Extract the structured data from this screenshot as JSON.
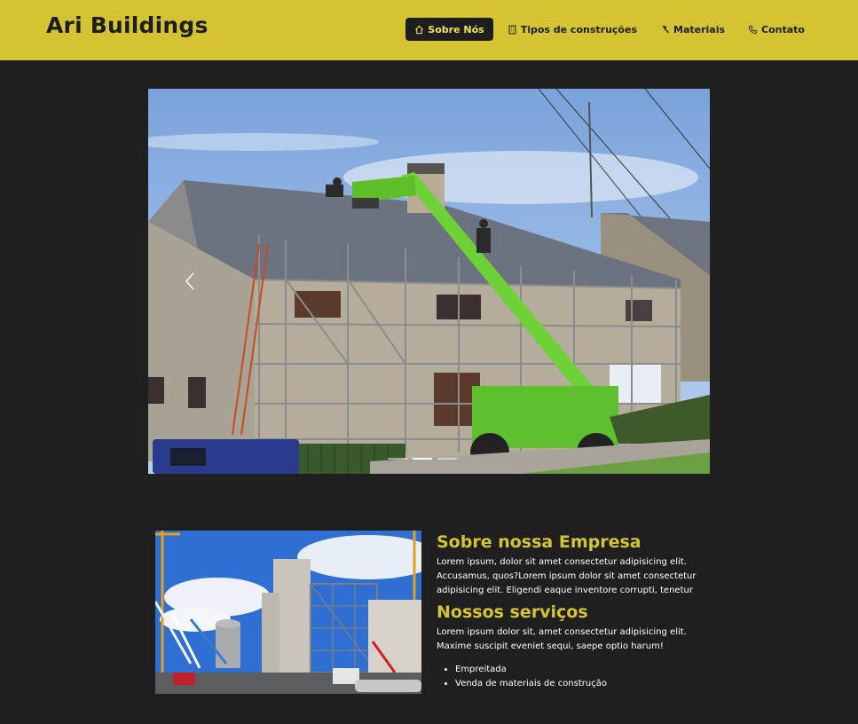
{
  "brand": {
    "name": "Ari Buildings"
  },
  "nav": {
    "items": [
      {
        "label": "Sobre Nós",
        "icon": "house-icon",
        "active": true
      },
      {
        "label": "Tipos de construções",
        "icon": "building-icon",
        "active": false
      },
      {
        "label": "Materiais",
        "icon": "hammer-icon",
        "active": false
      },
      {
        "label": "Contato",
        "icon": "phone-icon",
        "active": false
      }
    ]
  },
  "carousel": {
    "prev_icon": "chevron-left-icon",
    "next_icon": "chevron-right-icon",
    "slide_count": 3,
    "active_slide": 1
  },
  "about": {
    "heading": "Sobre nossa Empresa",
    "text": "Lorem ipsum, dolor sit amet consectetur adipisicing elit. Accusamus, quos?Lorem ipsum dolor sit amet consectetur adipisicing elit. Eligendi eaque inventore corrupti, tenetur",
    "services_heading": "Nossos serviços",
    "services_text": "Lorem ipsum dolor sit, amet consectetur adipisicing elit. Maxime suscipit eveniet sequi, saepe optio harum!",
    "services": [
      "Empreitada",
      "Venda de materiais de construção"
    ]
  },
  "colors": {
    "accent": "#d4c434",
    "background": "#1f1f1f",
    "nav_active_bg": "#1e1e1e"
  }
}
